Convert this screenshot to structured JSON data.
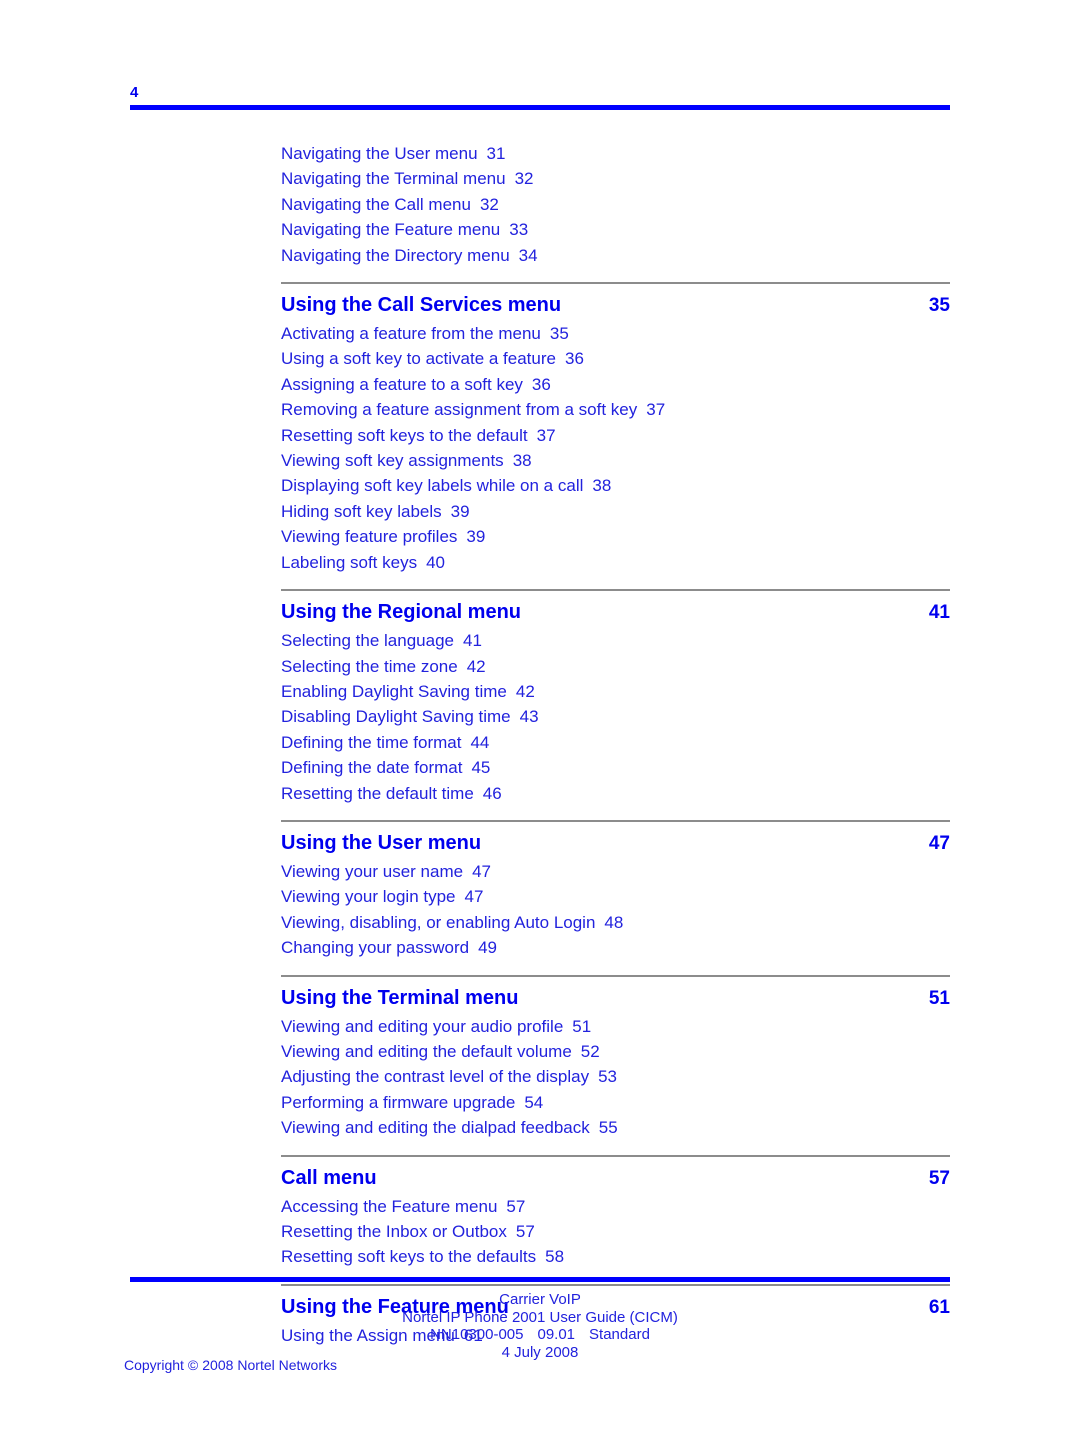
{
  "page": {
    "folio": "4",
    "accent_rule_color": "#0000FF",
    "heading_color": "#0000EE",
    "entry_color": "#2222DD",
    "separator_color": "#8c8c8c"
  },
  "toc": {
    "lead_entries": [
      {
        "title": "Navigating the User menu",
        "page": "31"
      },
      {
        "title": "Navigating the Terminal menu",
        "page": "32"
      },
      {
        "title": "Navigating the Call menu",
        "page": "32"
      },
      {
        "title": "Navigating the Feature menu",
        "page": "33"
      },
      {
        "title": "Navigating the Directory menu",
        "page": "34"
      }
    ],
    "sections": [
      {
        "title": "Using the Call Services menu",
        "page": "35",
        "entries": [
          {
            "title": "Activating a feature from the menu",
            "page": "35"
          },
          {
            "title": "Using a soft key to activate a feature",
            "page": "36"
          },
          {
            "title": "Assigning a feature to a soft key",
            "page": "36"
          },
          {
            "title": "Removing a feature assignment from a soft key",
            "page": "37"
          },
          {
            "title": "Resetting soft keys to the default",
            "page": "37"
          },
          {
            "title": "Viewing soft key assignments",
            "page": "38"
          },
          {
            "title": "Displaying soft key labels while on a call",
            "page": "38"
          },
          {
            "title": "Hiding soft key labels",
            "page": "39"
          },
          {
            "title": "Viewing feature profiles",
            "page": "39"
          },
          {
            "title": "Labeling soft keys",
            "page": "40"
          }
        ]
      },
      {
        "title": "Using the Regional menu",
        "page": "41",
        "entries": [
          {
            "title": "Selecting the language",
            "page": "41"
          },
          {
            "title": "Selecting the time zone",
            "page": "42"
          },
          {
            "title": "Enabling Daylight Saving time",
            "page": "42"
          },
          {
            "title": "Disabling Daylight Saving time",
            "page": "43"
          },
          {
            "title": "Defining the time format",
            "page": "44"
          },
          {
            "title": "Defining the date format",
            "page": "45"
          },
          {
            "title": "Resetting the default time",
            "page": "46"
          }
        ]
      },
      {
        "title": "Using the User menu",
        "page": "47",
        "entries": [
          {
            "title": "Viewing your user name",
            "page": "47"
          },
          {
            "title": "Viewing your login type",
            "page": "47"
          },
          {
            "title": "Viewing, disabling, or enabling Auto Login",
            "page": "48"
          },
          {
            "title": "Changing your password",
            "page": "49"
          }
        ]
      },
      {
        "title": "Using the Terminal menu",
        "page": "51",
        "entries": [
          {
            "title": "Viewing and editing your audio profile",
            "page": "51"
          },
          {
            "title": "Viewing and editing the default volume",
            "page": "52"
          },
          {
            "title": "Adjusting the contrast level of the display",
            "page": "53"
          },
          {
            "title": "Performing a firmware upgrade",
            "page": "54"
          },
          {
            "title": "Viewing and editing the dialpad feedback",
            "page": "55"
          }
        ]
      },
      {
        "title": "Call menu",
        "page": "57",
        "entries": [
          {
            "title": "Accessing the Feature menu",
            "page": "57"
          },
          {
            "title": "Resetting the Inbox or Outbox",
            "page": "57"
          },
          {
            "title": "Resetting soft keys to the defaults",
            "page": "58"
          }
        ]
      },
      {
        "title": "Using the Feature menu",
        "page": "61",
        "entries": [
          {
            "title": "Using the Assign menu",
            "page": "61"
          }
        ]
      }
    ]
  },
  "footer": {
    "line1": "Carrier VoIP",
    "line2": "Nortel IP Phone 2001 User Guide (CICM)",
    "line3_doc": "NN10300-005",
    "line3_issue": "09.01",
    "line3_status": "Standard",
    "line4": "4 July 2008",
    "copyright_word": "Copyright",
    "copyright_symbol": "©",
    "copyright_year": "2008",
    "copyright_owner": "Nortel Networks"
  }
}
